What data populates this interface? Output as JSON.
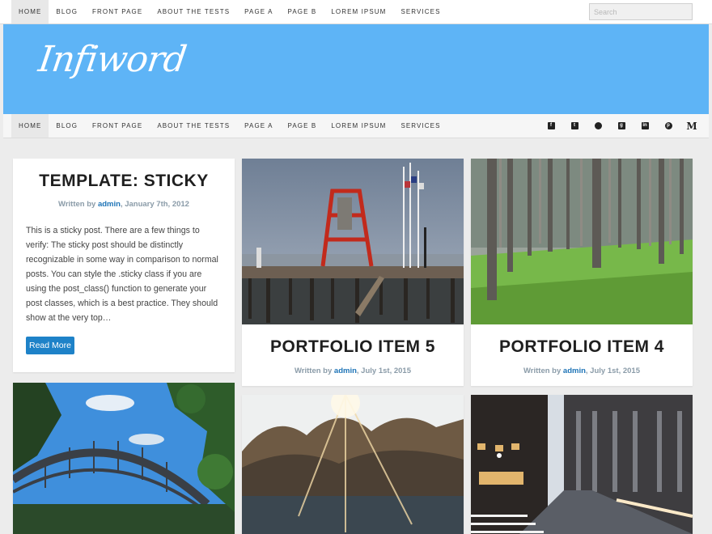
{
  "top_nav": {
    "items": [
      "Home",
      "Blog",
      "Front Page",
      "About The Tests",
      "Page A",
      "Page B",
      "Lorem Ipsum",
      "Services"
    ],
    "active_index": 0
  },
  "search": {
    "placeholder": "Search",
    "value": ""
  },
  "header": {
    "logo_text": "Infiword",
    "background_color": "#5eb4f6"
  },
  "main_nav": {
    "items": [
      "Home",
      "Blog",
      "Front Page",
      "About The Tests",
      "Page A",
      "Page B",
      "Lorem Ipsum",
      "Services"
    ],
    "active_index": 0,
    "social_icons": [
      "facebook-icon",
      "twitter-icon",
      "github-icon",
      "google-plus-icon",
      "linkedin-icon",
      "pinterest-icon",
      "medium-icon"
    ]
  },
  "sticky_post": {
    "title": "TEMPLATE: STICKY",
    "written_by": "Written by",
    "author": "admin",
    "date": ", January 7th, 2012",
    "excerpt": "This is a sticky post. There are a few things to verify: The sticky post should be distinctly recognizable in some way in comparison to normal posts. You can style the .sticky class if you are using the post_class() function to generate your post classes, which is a best practice. They should show at the very top…",
    "read_more": "Read More"
  },
  "portfolio_items": [
    {
      "title": "PORTFOLIO ITEM 5",
      "written_by": "Written by",
      "author": "admin",
      "date": ", July 1st, 2015",
      "image": "pier-with-red-tower"
    },
    {
      "title": "PORTFOLIO ITEM 4",
      "written_by": "Written by",
      "author": "admin",
      "date": ", July 1st, 2015",
      "image": "pine-forest-green-grass"
    }
  ],
  "bottom_images": [
    "harbour-bridge",
    "sunlit-lake-trees",
    "city-street-night"
  ],
  "colors": {
    "accent": "#1e82c8",
    "author_link": "#1e74b7",
    "meta": "#8a9ba8"
  }
}
